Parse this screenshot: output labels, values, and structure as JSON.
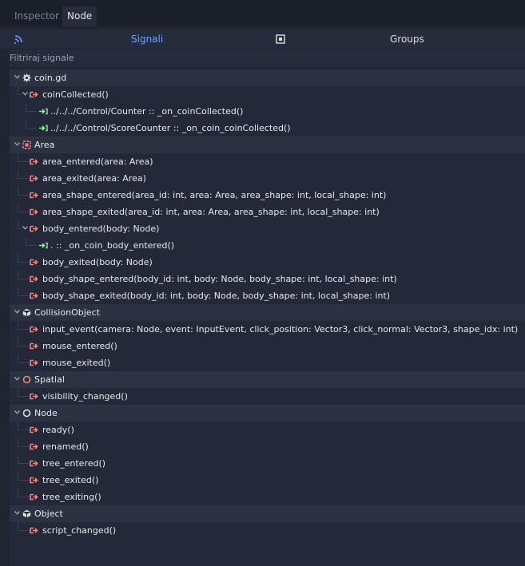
{
  "tabs": [
    {
      "label": "Inspector"
    },
    {
      "label": "Node"
    }
  ],
  "subtabs": {
    "signals_label": "Signali",
    "groups_label": "Groups"
  },
  "filter": {
    "label": "Filtriraj signale"
  },
  "tree": [
    {
      "kind": "cat",
      "depth": 0,
      "icon": "gear-icon",
      "text": "coin.gd"
    },
    {
      "kind": "signal",
      "depth": 1,
      "expanded": true,
      "text": "coinCollected()"
    },
    {
      "kind": "conn",
      "depth": 2,
      "text": "../../../Control/Counter :: _on_coinCollected()"
    },
    {
      "kind": "conn",
      "depth": 2,
      "text": "../../../Control/ScoreCounter :: _on_coin_coinCollected()"
    },
    {
      "kind": "cat",
      "depth": 0,
      "icon": "area-icon",
      "text": "Area"
    },
    {
      "kind": "signal",
      "depth": 1,
      "text": "area_entered(area: Area)"
    },
    {
      "kind": "signal",
      "depth": 1,
      "text": "area_exited(area: Area)"
    },
    {
      "kind": "signal",
      "depth": 1,
      "text": "area_shape_entered(area_id: int, area: Area, area_shape: int, local_shape: int)"
    },
    {
      "kind": "signal",
      "depth": 1,
      "text": "area_shape_exited(area_id: int, area: Area, area_shape: int, local_shape: int)"
    },
    {
      "kind": "signal",
      "depth": 1,
      "expanded": true,
      "text": "body_entered(body: Node)"
    },
    {
      "kind": "conn",
      "depth": 2,
      "text": ". :: _on_coin_body_entered()"
    },
    {
      "kind": "signal",
      "depth": 1,
      "text": "body_exited(body: Node)"
    },
    {
      "kind": "signal",
      "depth": 1,
      "text": "body_shape_entered(body_id: int, body: Node, body_shape: int, local_shape: int)"
    },
    {
      "kind": "signal",
      "depth": 1,
      "text": "body_shape_exited(body_id: int, body: Node, body_shape: int, local_shape: int)"
    },
    {
      "kind": "cat",
      "depth": 0,
      "icon": "cube-icon",
      "text": "CollisionObject"
    },
    {
      "kind": "signal",
      "depth": 1,
      "text": "input_event(camera: Node, event: InputEvent, click_position: Vector3, click_normal: Vector3, shape_idx: int)"
    },
    {
      "kind": "signal",
      "depth": 1,
      "text": "mouse_entered()"
    },
    {
      "kind": "signal",
      "depth": 1,
      "text": "mouse_exited()"
    },
    {
      "kind": "cat",
      "depth": 0,
      "icon": "spatial-icon",
      "text": "Spatial"
    },
    {
      "kind": "signal",
      "depth": 1,
      "text": "visibility_changed()"
    },
    {
      "kind": "cat",
      "depth": 0,
      "icon": "node-icon",
      "text": "Node"
    },
    {
      "kind": "signal",
      "depth": 1,
      "text": "ready()"
    },
    {
      "kind": "signal",
      "depth": 1,
      "text": "renamed()"
    },
    {
      "kind": "signal",
      "depth": 1,
      "text": "tree_entered()"
    },
    {
      "kind": "signal",
      "depth": 1,
      "text": "tree_exited()"
    },
    {
      "kind": "signal",
      "depth": 1,
      "text": "tree_exiting()"
    },
    {
      "kind": "cat",
      "depth": 0,
      "icon": "object-icon",
      "text": "Object"
    },
    {
      "kind": "signal",
      "depth": 1,
      "text": "script_changed()"
    }
  ]
}
